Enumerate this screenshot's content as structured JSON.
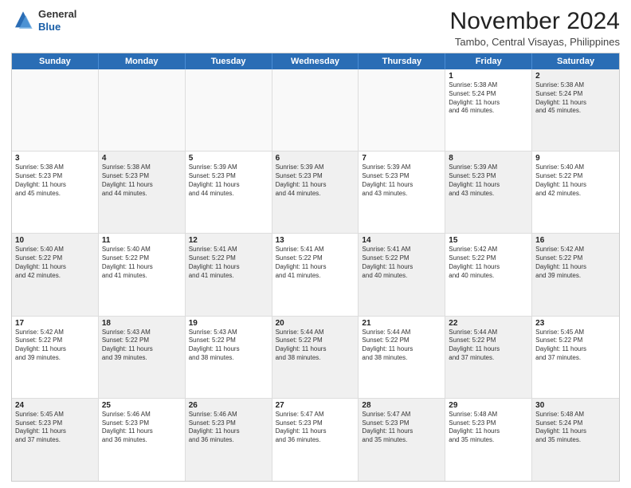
{
  "header": {
    "logo_general": "General",
    "logo_blue": "Blue",
    "month_title": "November 2024",
    "location": "Tambo, Central Visayas, Philippines"
  },
  "calendar": {
    "days_of_week": [
      "Sunday",
      "Monday",
      "Tuesday",
      "Wednesday",
      "Thursday",
      "Friday",
      "Saturday"
    ],
    "rows": [
      {
        "cells": [
          {
            "day": "",
            "info": "",
            "empty": true
          },
          {
            "day": "",
            "info": "",
            "empty": true
          },
          {
            "day": "",
            "info": "",
            "empty": true
          },
          {
            "day": "",
            "info": "",
            "empty": true
          },
          {
            "day": "",
            "info": "",
            "empty": true
          },
          {
            "day": "1",
            "info": "Sunrise: 5:38 AM\nSunset: 5:24 PM\nDaylight: 11 hours\nand 46 minutes.",
            "empty": false
          },
          {
            "day": "2",
            "info": "Sunrise: 5:38 AM\nSunset: 5:24 PM\nDaylight: 11 hours\nand 45 minutes.",
            "empty": false,
            "shaded": true
          }
        ]
      },
      {
        "cells": [
          {
            "day": "3",
            "info": "Sunrise: 5:38 AM\nSunset: 5:23 PM\nDaylight: 11 hours\nand 45 minutes.",
            "empty": false
          },
          {
            "day": "4",
            "info": "Sunrise: 5:38 AM\nSunset: 5:23 PM\nDaylight: 11 hours\nand 44 minutes.",
            "empty": false,
            "shaded": true
          },
          {
            "day": "5",
            "info": "Sunrise: 5:39 AM\nSunset: 5:23 PM\nDaylight: 11 hours\nand 44 minutes.",
            "empty": false
          },
          {
            "day": "6",
            "info": "Sunrise: 5:39 AM\nSunset: 5:23 PM\nDaylight: 11 hours\nand 44 minutes.",
            "empty": false,
            "shaded": true
          },
          {
            "day": "7",
            "info": "Sunrise: 5:39 AM\nSunset: 5:23 PM\nDaylight: 11 hours\nand 43 minutes.",
            "empty": false
          },
          {
            "day": "8",
            "info": "Sunrise: 5:39 AM\nSunset: 5:23 PM\nDaylight: 11 hours\nand 43 minutes.",
            "empty": false,
            "shaded": true
          },
          {
            "day": "9",
            "info": "Sunrise: 5:40 AM\nSunset: 5:22 PM\nDaylight: 11 hours\nand 42 minutes.",
            "empty": false
          }
        ]
      },
      {
        "cells": [
          {
            "day": "10",
            "info": "Sunrise: 5:40 AM\nSunset: 5:22 PM\nDaylight: 11 hours\nand 42 minutes.",
            "empty": false,
            "shaded": true
          },
          {
            "day": "11",
            "info": "Sunrise: 5:40 AM\nSunset: 5:22 PM\nDaylight: 11 hours\nand 41 minutes.",
            "empty": false
          },
          {
            "day": "12",
            "info": "Sunrise: 5:41 AM\nSunset: 5:22 PM\nDaylight: 11 hours\nand 41 minutes.",
            "empty": false,
            "shaded": true
          },
          {
            "day": "13",
            "info": "Sunrise: 5:41 AM\nSunset: 5:22 PM\nDaylight: 11 hours\nand 41 minutes.",
            "empty": false
          },
          {
            "day": "14",
            "info": "Sunrise: 5:41 AM\nSunset: 5:22 PM\nDaylight: 11 hours\nand 40 minutes.",
            "empty": false,
            "shaded": true
          },
          {
            "day": "15",
            "info": "Sunrise: 5:42 AM\nSunset: 5:22 PM\nDaylight: 11 hours\nand 40 minutes.",
            "empty": false
          },
          {
            "day": "16",
            "info": "Sunrise: 5:42 AM\nSunset: 5:22 PM\nDaylight: 11 hours\nand 39 minutes.",
            "empty": false,
            "shaded": true
          }
        ]
      },
      {
        "cells": [
          {
            "day": "17",
            "info": "Sunrise: 5:42 AM\nSunset: 5:22 PM\nDaylight: 11 hours\nand 39 minutes.",
            "empty": false
          },
          {
            "day": "18",
            "info": "Sunrise: 5:43 AM\nSunset: 5:22 PM\nDaylight: 11 hours\nand 39 minutes.",
            "empty": false,
            "shaded": true
          },
          {
            "day": "19",
            "info": "Sunrise: 5:43 AM\nSunset: 5:22 PM\nDaylight: 11 hours\nand 38 minutes.",
            "empty": false
          },
          {
            "day": "20",
            "info": "Sunrise: 5:44 AM\nSunset: 5:22 PM\nDaylight: 11 hours\nand 38 minutes.",
            "empty": false,
            "shaded": true
          },
          {
            "day": "21",
            "info": "Sunrise: 5:44 AM\nSunset: 5:22 PM\nDaylight: 11 hours\nand 38 minutes.",
            "empty": false
          },
          {
            "day": "22",
            "info": "Sunrise: 5:44 AM\nSunset: 5:22 PM\nDaylight: 11 hours\nand 37 minutes.",
            "empty": false,
            "shaded": true
          },
          {
            "day": "23",
            "info": "Sunrise: 5:45 AM\nSunset: 5:22 PM\nDaylight: 11 hours\nand 37 minutes.",
            "empty": false
          }
        ]
      },
      {
        "cells": [
          {
            "day": "24",
            "info": "Sunrise: 5:45 AM\nSunset: 5:23 PM\nDaylight: 11 hours\nand 37 minutes.",
            "empty": false,
            "shaded": true
          },
          {
            "day": "25",
            "info": "Sunrise: 5:46 AM\nSunset: 5:23 PM\nDaylight: 11 hours\nand 36 minutes.",
            "empty": false
          },
          {
            "day": "26",
            "info": "Sunrise: 5:46 AM\nSunset: 5:23 PM\nDaylight: 11 hours\nand 36 minutes.",
            "empty": false,
            "shaded": true
          },
          {
            "day": "27",
            "info": "Sunrise: 5:47 AM\nSunset: 5:23 PM\nDaylight: 11 hours\nand 36 minutes.",
            "empty": false
          },
          {
            "day": "28",
            "info": "Sunrise: 5:47 AM\nSunset: 5:23 PM\nDaylight: 11 hours\nand 35 minutes.",
            "empty": false,
            "shaded": true
          },
          {
            "day": "29",
            "info": "Sunrise: 5:48 AM\nSunset: 5:23 PM\nDaylight: 11 hours\nand 35 minutes.",
            "empty": false
          },
          {
            "day": "30",
            "info": "Sunrise: 5:48 AM\nSunset: 5:24 PM\nDaylight: 11 hours\nand 35 minutes.",
            "empty": false,
            "shaded": true
          }
        ]
      }
    ]
  }
}
